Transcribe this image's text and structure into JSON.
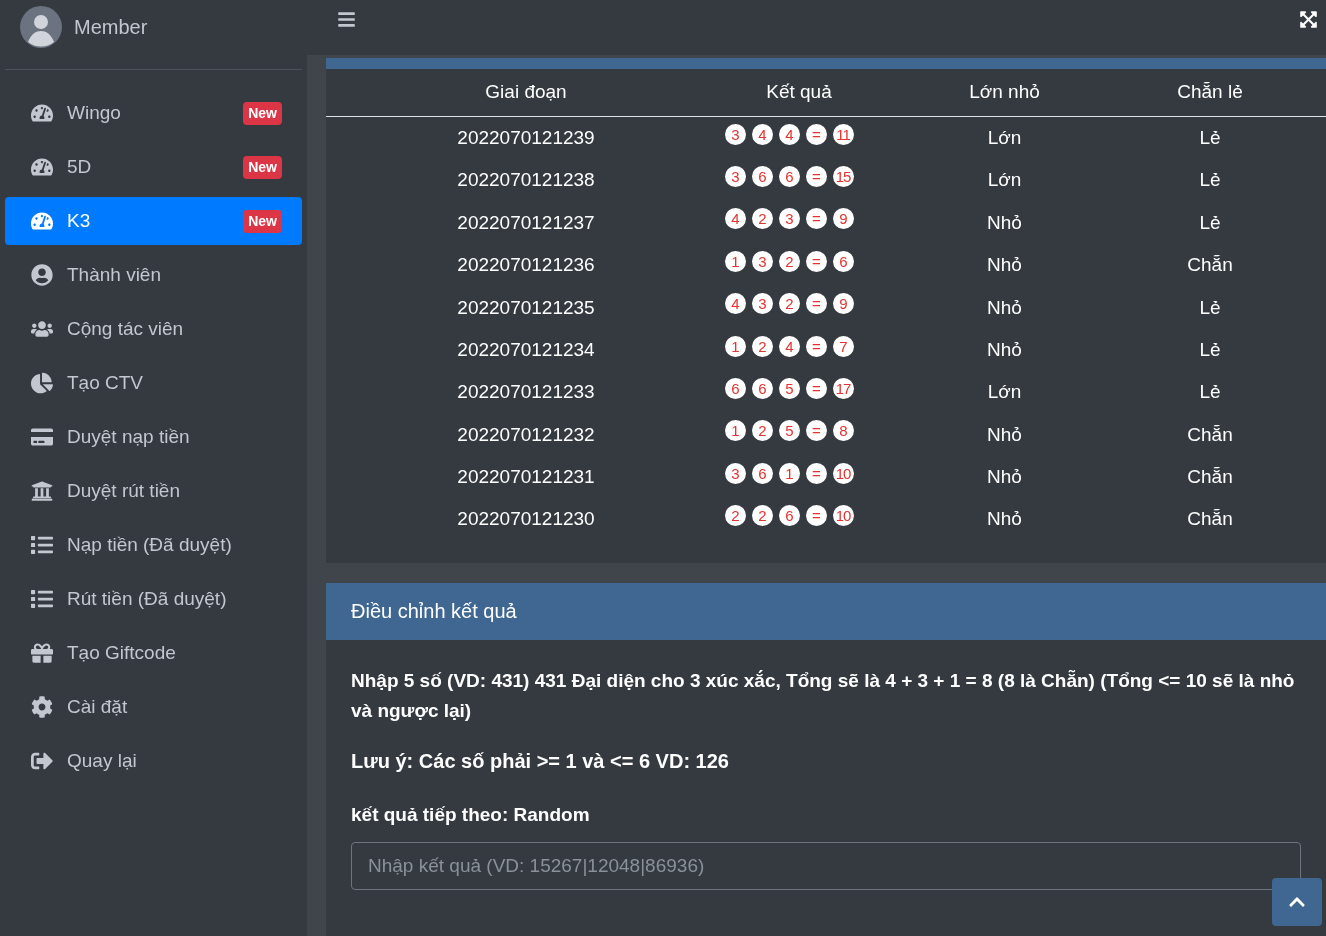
{
  "sidebar": {
    "user": "Member",
    "items": [
      {
        "label": "Wingo",
        "badge": "New",
        "selected": false
      },
      {
        "label": "5D",
        "badge": "New",
        "selected": false
      },
      {
        "label": "K3",
        "badge": "New",
        "selected": true
      },
      {
        "label": "Thành viên",
        "selected": false
      },
      {
        "label": "Cộng tác viên",
        "selected": false
      },
      {
        "label": "Tạo CTV",
        "selected": false
      },
      {
        "label": "Duyệt nạp tiền",
        "selected": false
      },
      {
        "label": "Duyệt rút tiền",
        "selected": false
      },
      {
        "label": "Nạp tiền (Đã duyệt)",
        "selected": false
      },
      {
        "label": "Rút tiền (Đã duyệt)",
        "selected": false
      },
      {
        "label": "Tạo Giftcode",
        "selected": false
      },
      {
        "label": "Cài đặt",
        "selected": false
      },
      {
        "label": "Quay lại",
        "selected": false
      }
    ]
  },
  "table": {
    "columns": [
      "Giai đoạn",
      "Kết quả",
      "Lớn nhỏ",
      "Chẵn lẻ"
    ],
    "rows": [
      {
        "period": "2022070121239",
        "dice": [
          "3",
          "4",
          "4"
        ],
        "eq": "=",
        "sum": "11",
        "size": "Lớn",
        "parity": "Lẻ"
      },
      {
        "period": "2022070121238",
        "dice": [
          "3",
          "6",
          "6"
        ],
        "eq": "=",
        "sum": "15",
        "size": "Lớn",
        "parity": "Lẻ"
      },
      {
        "period": "2022070121237",
        "dice": [
          "4",
          "2",
          "3"
        ],
        "eq": "=",
        "sum": "9",
        "size": "Nhỏ",
        "parity": "Lẻ"
      },
      {
        "period": "2022070121236",
        "dice": [
          "1",
          "3",
          "2"
        ],
        "eq": "=",
        "sum": "6",
        "size": "Nhỏ",
        "parity": "Chẵn"
      },
      {
        "period": "2022070121235",
        "dice": [
          "4",
          "3",
          "2"
        ],
        "eq": "=",
        "sum": "9",
        "size": "Nhỏ",
        "parity": "Lẻ"
      },
      {
        "period": "2022070121234",
        "dice": [
          "1",
          "2",
          "4"
        ],
        "eq": "=",
        "sum": "7",
        "size": "Nhỏ",
        "parity": "Lẻ"
      },
      {
        "period": "2022070121233",
        "dice": [
          "6",
          "6",
          "5"
        ],
        "eq": "=",
        "sum": "17",
        "size": "Lớn",
        "parity": "Lẻ"
      },
      {
        "period": "2022070121232",
        "dice": [
          "1",
          "2",
          "5"
        ],
        "eq": "=",
        "sum": "8",
        "size": "Nhỏ",
        "parity": "Chẵn"
      },
      {
        "period": "2022070121231",
        "dice": [
          "3",
          "6",
          "1"
        ],
        "eq": "=",
        "sum": "10",
        "size": "Nhỏ",
        "parity": "Chẵn"
      },
      {
        "period": "2022070121230",
        "dice": [
          "2",
          "2",
          "6"
        ],
        "eq": "=",
        "sum": "10",
        "size": "Nhỏ",
        "parity": "Chẵn"
      }
    ]
  },
  "adjust": {
    "title": "Điều chỉnh kết quả",
    "instructions": "Nhập 5 số (VD: 431) 431 Đại diện cho 3 xúc xắc, Tổng sẽ là 4 + 3 + 1 = 8 (8 là Chẵn) (Tổng <= 10 sẽ là nhỏ và ngược lại)",
    "note": "Lưu ý: Các số phải >= 1 và <= 6 VD: 126",
    "next": "kết quả tiếp theo: Random",
    "placeholder": "Nhập kết quả (VD: 15267|12048|86936)"
  }
}
